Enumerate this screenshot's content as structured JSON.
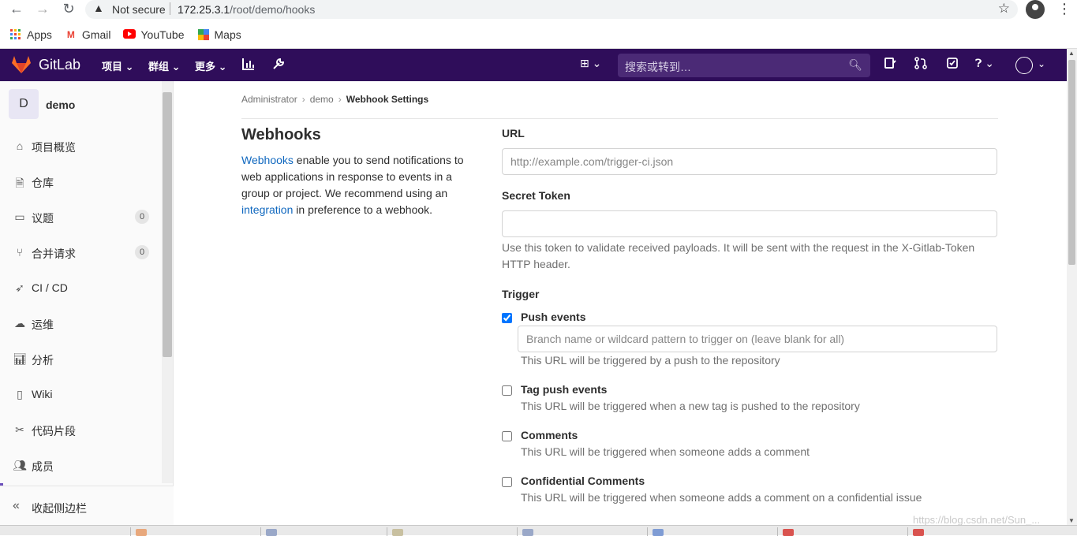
{
  "browser": {
    "security_label": "Not secure",
    "url_host": "172.25.3.1",
    "url_path": "/root/demo/hooks",
    "bookmarks": [
      {
        "label": "Apps",
        "icon": "apps-grid-icon"
      },
      {
        "label": "Gmail",
        "icon": "gmail-icon"
      },
      {
        "label": "YouTube",
        "icon": "youtube-icon"
      },
      {
        "label": "Maps",
        "icon": "maps-icon"
      }
    ]
  },
  "header": {
    "brand": "GitLab",
    "nav": [
      "项目",
      "群组",
      "更多"
    ],
    "search_placeholder": "搜索或转到…",
    "colors": {
      "bar": "#2f0d5a",
      "search": "#4b2a76"
    }
  },
  "sidebar": {
    "project_initial": "D",
    "project_name": "demo",
    "items": [
      {
        "label": "项目概览",
        "icon": "home-icon"
      },
      {
        "label": "仓库",
        "icon": "document-icon"
      },
      {
        "label": "议题",
        "icon": "issues-icon",
        "badge": "0"
      },
      {
        "label": "合并请求",
        "icon": "merge-request-icon",
        "badge": "0"
      },
      {
        "label": "CI / CD",
        "icon": "rocket-icon"
      },
      {
        "label": "运维",
        "icon": "cloud-icon"
      },
      {
        "label": "分析",
        "icon": "chart-icon"
      },
      {
        "label": "Wiki",
        "icon": "book-icon"
      },
      {
        "label": "代码片段",
        "icon": "scissors-icon"
      },
      {
        "label": "成员",
        "icon": "users-icon"
      }
    ],
    "collapse_label": "收起侧边栏"
  },
  "breadcrumb": {
    "items": [
      "Administrator",
      "demo"
    ],
    "current": "Webhook Settings"
  },
  "intro": {
    "title": "Webhooks",
    "link_webhooks": "Webhooks",
    "text_1": " enable you to send notifications to web applications in response to events in a group or project. We recommend using an ",
    "link_integration": "integration",
    "text_2": " in preference to a webhook."
  },
  "form": {
    "url_label": "URL",
    "url_placeholder": "http://example.com/trigger-ci.json",
    "token_label": "Secret Token",
    "token_help": "Use this token to validate received payloads. It will be sent with the request in the X-Gitlab-Token HTTP header.",
    "trigger_label": "Trigger",
    "triggers": [
      {
        "label": "Push events",
        "checked": true,
        "help": "This URL will be triggered by a push to the repository"
      },
      {
        "label": "Tag push events",
        "checked": false,
        "help": "This URL will be triggered when a new tag is pushed to the repository"
      },
      {
        "label": "Comments",
        "checked": false,
        "help": "This URL will be triggered when someone adds a comment"
      },
      {
        "label": "Confidential Comments",
        "checked": false,
        "help": "This URL will be triggered when someone adds a comment on a confidential issue"
      }
    ],
    "branch_placeholder": "Branch name or wildcard pattern to trigger on (leave blank for all)"
  },
  "watermark": "https://blog.csdn.net/Sun_..."
}
